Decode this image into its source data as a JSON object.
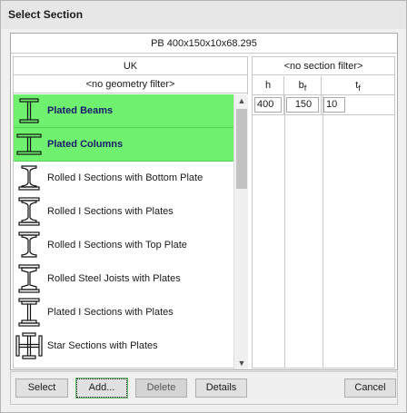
{
  "dialog": {
    "title": "Select Section"
  },
  "section_name": "PB 400x150x10x68.295",
  "left_panel": {
    "header": "UK",
    "filter": "<no geometry filter>",
    "items": [
      {
        "label": "Plated Beams",
        "selected": true,
        "icon": "plated-beam-icon"
      },
      {
        "label": "Plated Columns",
        "selected": true,
        "icon": "plated-column-icon"
      },
      {
        "label": "Rolled I Sections with Bottom Plate",
        "selected": false,
        "icon": "i-section-bottom-plate-icon"
      },
      {
        "label": "Rolled I Sections with Plates",
        "selected": false,
        "icon": "i-section-plates-icon"
      },
      {
        "label": "Rolled I Sections with Top Plate",
        "selected": false,
        "icon": "i-section-top-plate-icon"
      },
      {
        "label": "Rolled Steel Joists with Plates",
        "selected": false,
        "icon": "steel-joist-plates-icon"
      },
      {
        "label": "Plated I Sections with Plates",
        "selected": false,
        "icon": "plated-i-section-icon"
      },
      {
        "label": "Star Sections with Plates",
        "selected": false,
        "icon": "star-section-icon"
      }
    ]
  },
  "right_panel": {
    "filter": "<no section filter>",
    "headers": [
      "h",
      "b",
      "t"
    ],
    "header_subscripts": [
      "",
      "f",
      "f"
    ],
    "values": [
      "400",
      "150",
      "10"
    ]
  },
  "buttons": {
    "select": "Select",
    "add": "Add...",
    "delete": "Delete",
    "details": "Details",
    "cancel": "Cancel"
  },
  "colors": {
    "selected_row": "#6ff06f",
    "selected_text": "#1a1a6e"
  }
}
